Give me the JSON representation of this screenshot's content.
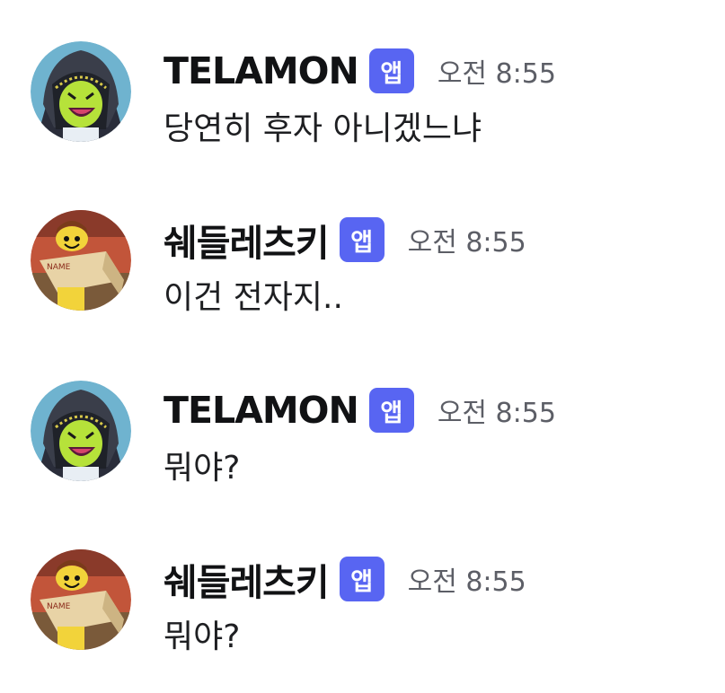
{
  "badge_label": "앱",
  "colors": {
    "badge_bg": "#5865f2",
    "username": "#111214",
    "timestamp": "#5c5e66",
    "message_text": "#1e1f22"
  },
  "messages": [
    {
      "username": "TELAMON",
      "avatar_icon": "hooded-lego-avatar-icon",
      "timestamp": "오전 8:55",
      "text": "당연히 후자 아니겠느냐"
    },
    {
      "username": "쉐들레츠키",
      "avatar_icon": "lego-figure-with-box-avatar-icon",
      "timestamp": "오전 8:55",
      "text": "이건 전자지.."
    },
    {
      "username": "TELAMON",
      "avatar_icon": "hooded-lego-avatar-icon",
      "timestamp": "오전 8:55",
      "text": "뭐야?"
    },
    {
      "username": "쉐들레츠키",
      "avatar_icon": "lego-figure-with-box-avatar-icon",
      "timestamp": "오전 8:55",
      "text": "뭐야?"
    }
  ]
}
